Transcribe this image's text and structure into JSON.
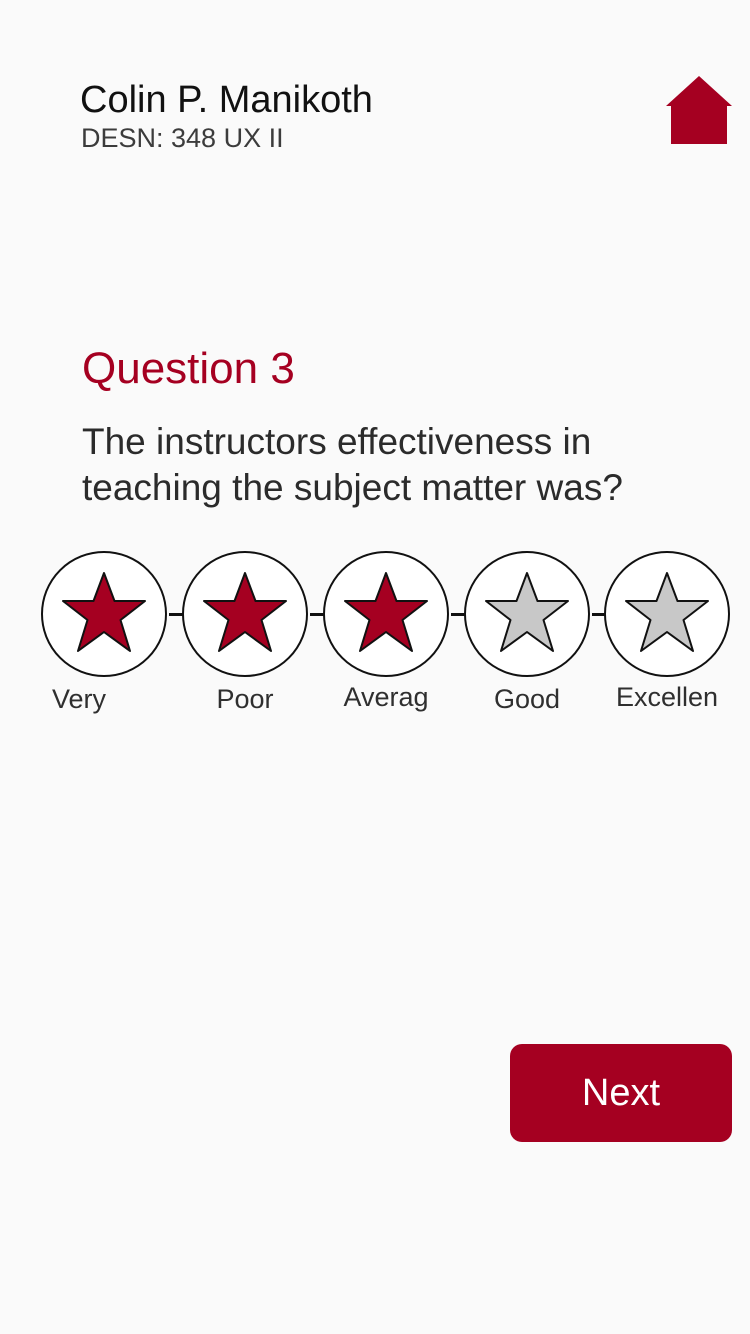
{
  "header": {
    "instructor_name": "Colin P. Manikoth",
    "course_code": "DESN: 348 UX II",
    "home_icon": "home-icon"
  },
  "question": {
    "number_label": "Question 3",
    "text": "The instructors effectiveness in teaching the subject matter was?"
  },
  "rating": {
    "selected_value": 3,
    "max_value": 5,
    "options": [
      {
        "label": "Very",
        "icon": "star-icon",
        "filled": true
      },
      {
        "label": "Poor",
        "icon": "star-icon",
        "filled": true
      },
      {
        "label": "Averag",
        "icon": "star-icon",
        "filled": true
      },
      {
        "label": "Good",
        "icon": "star-icon",
        "filled": false
      },
      {
        "label": "Excellen",
        "icon": "star-icon",
        "filled": false
      }
    ]
  },
  "footer": {
    "next_label": "Next"
  },
  "colors": {
    "accent": "#a50021",
    "star_filled": "#a50021",
    "star_empty": "#c8c8c8",
    "background": "#fafafa",
    "text": "#2b2b2b"
  }
}
